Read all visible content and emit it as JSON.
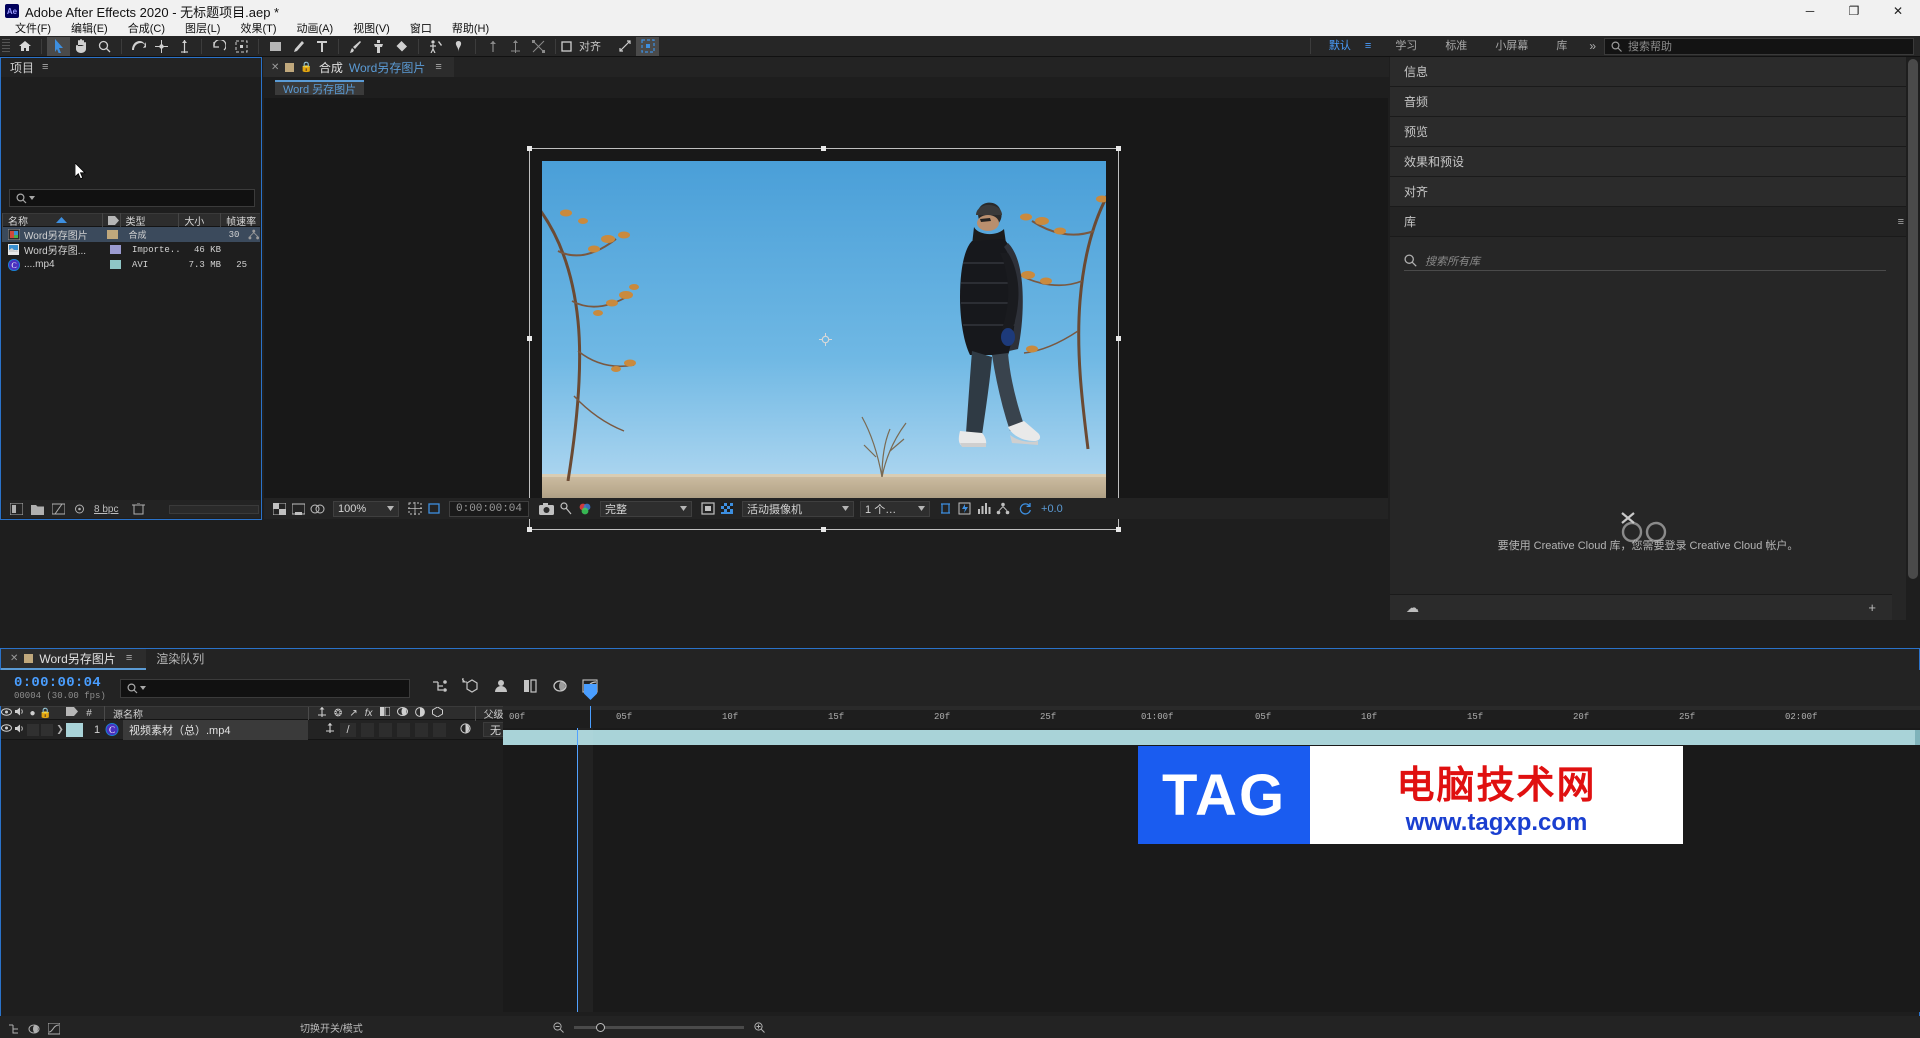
{
  "window": {
    "app_badge": "Ae",
    "title": "Adobe After Effects 2020 - 无标题项目.aep *",
    "minimize": "─",
    "maximize": "❐",
    "close": "✕"
  },
  "menubar": [
    "文件(F)",
    "编辑(E)",
    "合成(C)",
    "图层(L)",
    "效果(T)",
    "动画(A)",
    "视图(V)",
    "窗口",
    "帮助(H)"
  ],
  "toolbar": {
    "align_label": "对齐",
    "workspaces": [
      "默认",
      "学习",
      "标准",
      "小屏幕",
      "库"
    ],
    "active_workspace": "默认",
    "more": "»",
    "help_placeholder": "搜索帮助"
  },
  "project": {
    "title": "项目",
    "menu": "≡",
    "search_placeholder": "",
    "columns": [
      "名称",
      "类型",
      "大小",
      "帧速率"
    ],
    "items": [
      {
        "name": "Word另存图片",
        "type": "合成",
        "size": "",
        "fps": "30",
        "icon": "composition-icon",
        "swatch": "#c0a87c",
        "selected": true
      },
      {
        "name": "Word另存图...",
        "type": "Importe...G",
        "size": "46 KB",
        "fps": "",
        "icon": "image-file-icon",
        "swatch": "#9a9ad0",
        "selected": false
      },
      {
        "name": "....mp4",
        "type": "AVI",
        "size": "7.3 MB",
        "fps": "25",
        "icon": "video-file-icon",
        "swatch": "#8fc6c6",
        "selected": false
      }
    ],
    "footer": {
      "bpc": "8 bpc"
    }
  },
  "composition": {
    "tab_close": "✕",
    "tab_prefix": "合成",
    "tab_name": "Word另存图片",
    "tab_menu": "≡",
    "subtab": "Word 另存图片",
    "footer": {
      "zoom": "100%",
      "time": "0:00:00:04",
      "resolution": "完整",
      "camera": "活动摄像机",
      "views": "1 个…",
      "exposure": "+0.0"
    }
  },
  "right_dock": {
    "panels": [
      "信息",
      "音频",
      "预览",
      "效果和预设",
      "对齐"
    ],
    "library": {
      "title": "库",
      "menu": "≡",
      "search_placeholder": "搜索所有库",
      "message": "要使用 Creative Cloud 库，您需要登录 Creative Cloud 帐户。"
    }
  },
  "timeline": {
    "tabs": [
      {
        "label": "Word另存图片",
        "active": true
      },
      {
        "label": "渲染队列",
        "active": false
      }
    ],
    "time_big": "0:00:00:04",
    "time_small": "00004 (30.00 fps)",
    "search_placeholder": "",
    "columns": [
      "#",
      "源名称",
      "父级和链接"
    ],
    "layers": [
      {
        "index": "1",
        "name": "视频素材（总）.mp4",
        "parent": "无",
        "color": "#a9d3d8"
      }
    ],
    "ruler_ticks": [
      "00f",
      "05f",
      "10f",
      "15f",
      "20f",
      "25f",
      "01:00f",
      "05f",
      "10f",
      "15f",
      "20f",
      "25f",
      "02:00f"
    ],
    "footer_switch": "切换开关/模式"
  },
  "watermark": {
    "tag": "TAG",
    "cn": "电脑技术网",
    "url": "www.tagxp.com"
  },
  "colors": {
    "accent": "#4a9eff",
    "panel_bg": "#1e1e1e",
    "header_bg": "#232323",
    "green_render": "#3fbf54"
  }
}
